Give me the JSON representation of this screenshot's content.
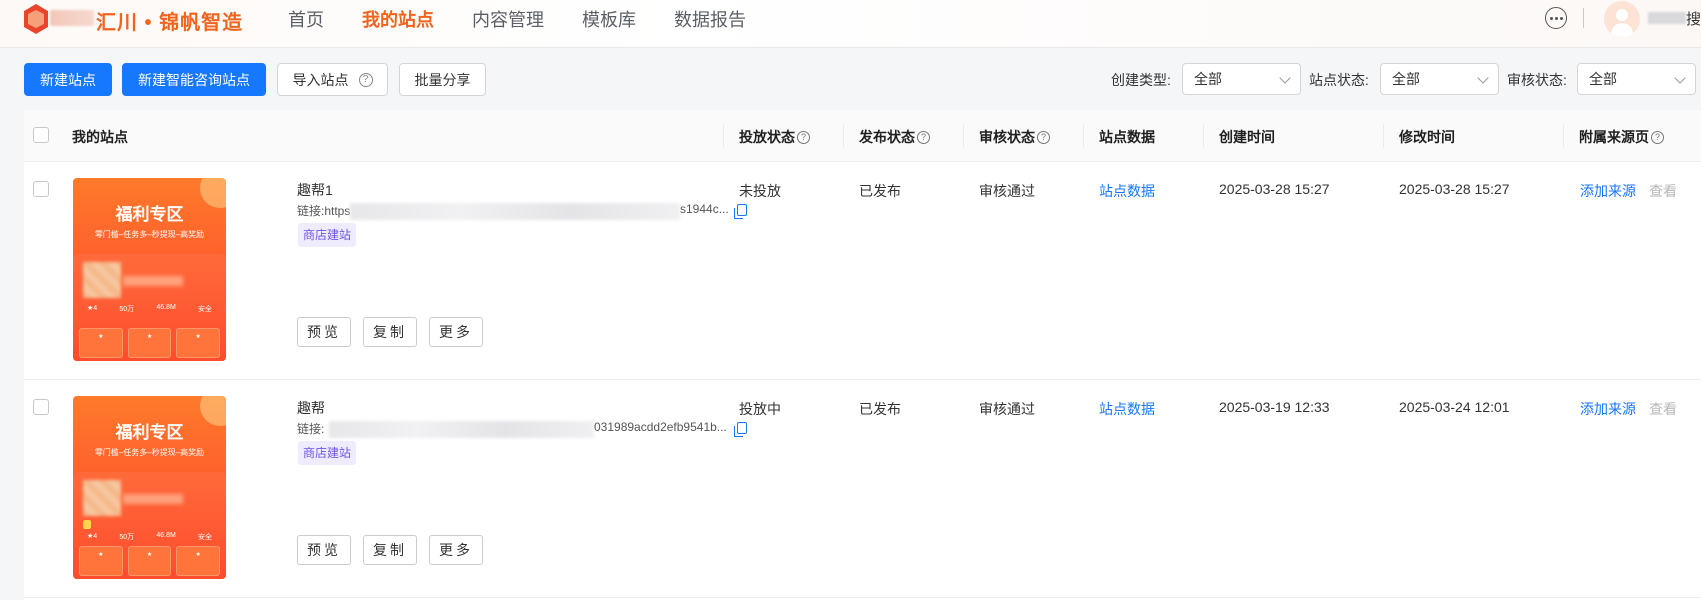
{
  "header": {
    "brand": "汇川 • 锦帆智造",
    "nav": [
      {
        "label": "首页",
        "active": false
      },
      {
        "label": "我的站点",
        "active": true
      },
      {
        "label": "内容管理",
        "active": false
      },
      {
        "label": "模板库",
        "active": false
      },
      {
        "label": "数据报告",
        "active": false
      }
    ],
    "user_suffix": "搜",
    "accent_color": "#f0641e"
  },
  "toolbar": {
    "new_site": "新建站点",
    "new_ai_site": "新建智能咨询站点",
    "import_site": "导入站点",
    "batch_share": "批量分享",
    "filters": [
      {
        "label": "创建类型:",
        "value": "全部"
      },
      {
        "label": "站点状态:",
        "value": "全部"
      },
      {
        "label": "审核状态:",
        "value": "全部"
      }
    ]
  },
  "table": {
    "columns": {
      "site": "我的站点",
      "delivery": "投放状态",
      "publish": "发布状态",
      "review": "审核状态",
      "data": "站点数据",
      "created": "创建时间",
      "modified": "修改时间",
      "source": "附属来源页"
    },
    "rows": [
      {
        "name": "趣帮1",
        "link_prefix": "链接:https",
        "link_tail": "s1944c...",
        "tag": "商店建站",
        "thumb_title": "福利专区",
        "thumb_sub": "零门槛–任务多–秒提现–高奖励",
        "delivery": "未投放",
        "publish": "已发布",
        "review": "审核通过",
        "data_link": "站点数据",
        "created": "2025-03-28 15:27",
        "modified": "2025-03-28 15:27",
        "add_source": "添加来源",
        "view": "查看",
        "actions": [
          "预览",
          "复制",
          "更多"
        ]
      },
      {
        "name": "趣帮",
        "link_prefix": "链接:",
        "link_tail": "031989acdd2efb9541b...",
        "tag": "商店建站",
        "thumb_title": "福利专区",
        "thumb_sub": "零门槛–任务多–秒提现–高奖励",
        "delivery": "投放中",
        "publish": "已发布",
        "review": "审核通过",
        "data_link": "站点数据",
        "created": "2025-03-19 12:33",
        "modified": "2025-03-24 12:01",
        "add_source": "添加来源",
        "view": "查看",
        "actions": [
          "预览",
          "复制",
          "更多"
        ]
      }
    ]
  }
}
